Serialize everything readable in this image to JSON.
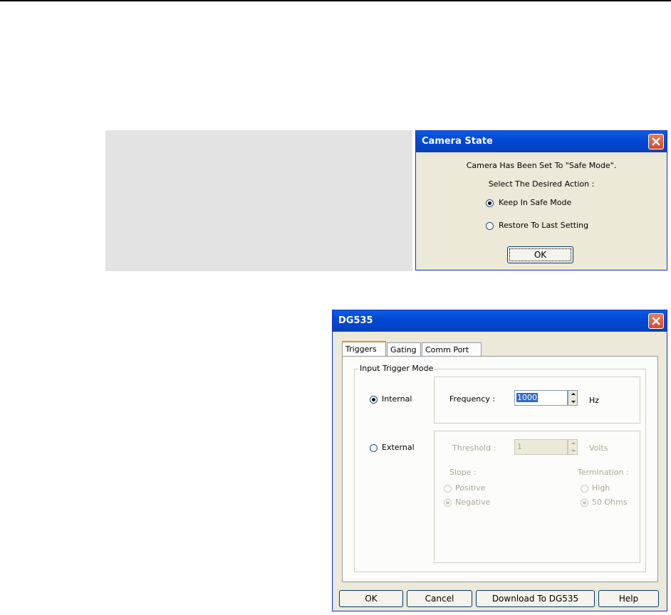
{
  "camera_dialog": {
    "title": "Camera State",
    "message": "Camera Has Been Set To \"Safe Mode\".",
    "prompt": "Select The Desired Action :",
    "option_keep": "Keep In Safe Mode",
    "option_restore": "Restore To Last Setting",
    "selected": "keep",
    "ok_label": "OK"
  },
  "dg535_dialog": {
    "title": "DG535",
    "tabs": [
      {
        "label": "Triggers",
        "active": true
      },
      {
        "label": "Gating",
        "active": false
      },
      {
        "label": "Comm Port",
        "active": false
      }
    ],
    "group_title": "Input Trigger Mode",
    "internal_label": "Internal",
    "external_label": "External",
    "selected_mode": "internal",
    "frequency_label": "Frequency :",
    "frequency_value": "1000",
    "frequency_unit": "Hz",
    "threshold_label": "Threshold :",
    "threshold_value": "1",
    "threshold_unit": "Volts",
    "slope_label": "Slope :",
    "slope_positive": "Positive",
    "slope_negative": "Negative",
    "termination_label": "Termination :",
    "termination_high": "High",
    "termination_50": "50 Ohms",
    "buttons": {
      "ok": "OK",
      "cancel": "Cancel",
      "download": "Download To DG535",
      "help": "Help"
    }
  }
}
